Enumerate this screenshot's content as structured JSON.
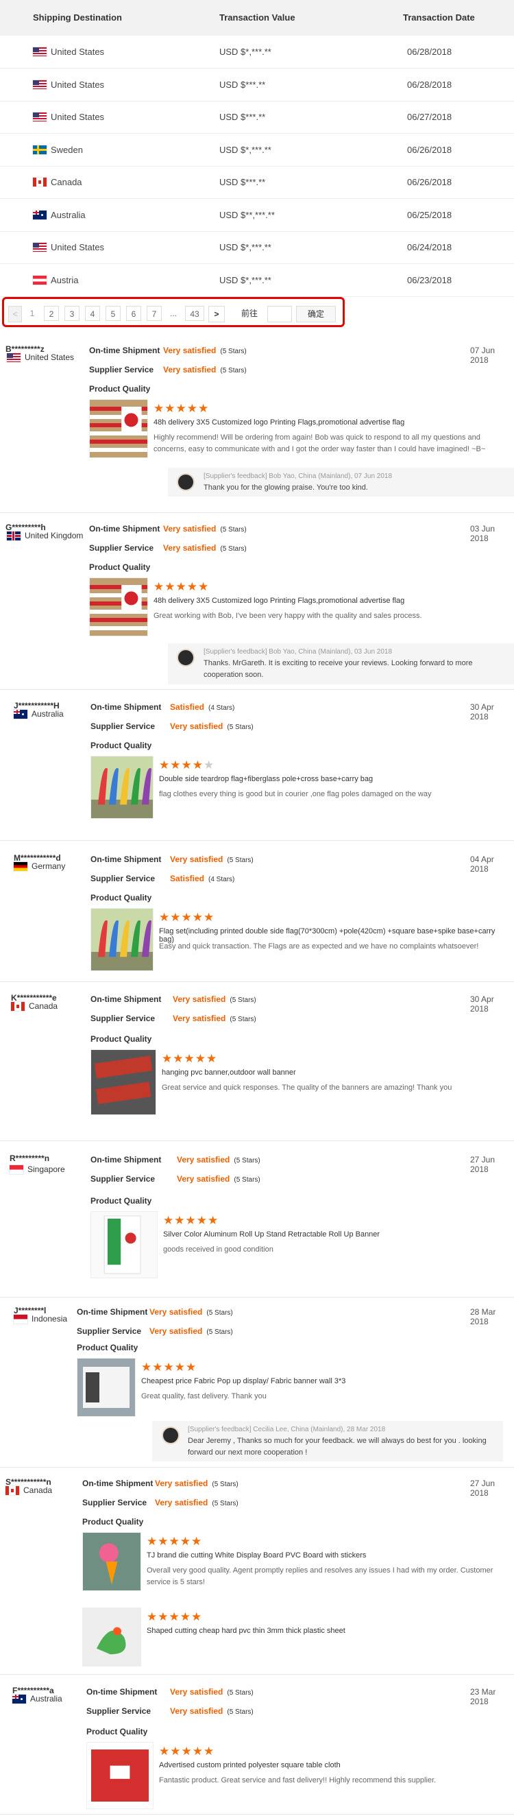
{
  "transactions": {
    "headers": {
      "dest": "Shipping Destination",
      "value": "Transaction Value",
      "date": "Transaction Date"
    },
    "rows": [
      {
        "flag": "us",
        "country": "United States",
        "value": "USD $*,***.**",
        "date": "06/28/2018"
      },
      {
        "flag": "us",
        "country": "United States",
        "value": "USD $***.**",
        "date": "06/28/2018"
      },
      {
        "flag": "us",
        "country": "United States",
        "value": "USD $***.**",
        "date": "06/27/2018"
      },
      {
        "flag": "se",
        "country": "Sweden",
        "value": "USD $*,***.**",
        "date": "06/26/2018"
      },
      {
        "flag": "ca",
        "country": "Canada",
        "value": "USD $***.**",
        "date": "06/26/2018"
      },
      {
        "flag": "au",
        "country": "Australia",
        "value": "USD $**,***.**",
        "date": "06/25/2018"
      },
      {
        "flag": "us",
        "country": "United States",
        "value": "USD $*,***.**",
        "date": "06/24/2018"
      },
      {
        "flag": "at",
        "country": "Austria",
        "value": "USD $*,***.**",
        "date": "06/23/2018"
      }
    ]
  },
  "pager": {
    "prev": "<",
    "pages": [
      "1",
      "2",
      "3",
      "4",
      "5",
      "6",
      "7"
    ],
    "ellipsis": "...",
    "last": "43",
    "next": ">",
    "goto_label": "前往",
    "confirm": "确定",
    "current": "1",
    "accent": "#e10600"
  },
  "labels": {
    "shipment": "On-time Shipment",
    "service": "Supplier Service",
    "quality": "Product Quality"
  },
  "reviews": [
    {
      "buyer": "B*********z",
      "country": "United States",
      "flag": "us",
      "date": "07 Jun 2018",
      "shipment": "Very satisfied",
      "shipment_stars": "(5 Stars)",
      "service": "Very satisfied",
      "service_stars": "(5 Stars)",
      "items": [
        {
          "stars": 5,
          "product": "48h delivery 3X5 Customized logo Printing Flags,promotional advertise flag",
          "comment": "Highly recommend! Will be ordering from again! Bob was quick to respond to all my questions and concerns, easy to communicate with and I got the order way faster than I could have imagined! ~B~"
        }
      ],
      "feedback": {
        "header": "[Supplier's feedback] Bob Yao, China (Mainland), 07 Jun 2018",
        "body": "Thank you for the glowing praise. You're too kind."
      }
    },
    {
      "buyer": "G*********h",
      "country": "United Kingdom",
      "flag": "gb",
      "date": "03 Jun 2018",
      "shipment": "Very satisfied",
      "shipment_stars": "(5 Stars)",
      "service": "Very satisfied",
      "service_stars": "(5 Stars)",
      "items": [
        {
          "stars": 5,
          "product": "48h delivery 3X5 Customized logo Printing Flags,promotional advertise flag",
          "comment": "Great working with Bob, I've been very happy with the quality and sales process."
        }
      ],
      "feedback": {
        "header": "[Supplier's feedback] Bob Yao, China (Mainland), 03 Jun 2018",
        "body": "Thanks. MrGareth. It is exciting to receive your reviews. Looking forward to more cooperation soon."
      }
    },
    {
      "buyer": "J***********H",
      "country": "Australia",
      "flag": "au",
      "date": "30 Apr 2018",
      "shipment": "Satisfied",
      "shipment_stars": "(4 Stars)",
      "service": "Very satisfied",
      "service_stars": "(5 Stars)",
      "items": [
        {
          "stars": 4,
          "product": "Double side teardrop flag+fiberglass pole+cross base+carry bag",
          "comment": "flag clothes every thing is good but in courier ,one flag poles damaged on the way"
        }
      ]
    },
    {
      "buyer": "M***********d",
      "country": "Germany",
      "flag": "de",
      "date": "04 Apr 2018",
      "shipment": "Very satisfied",
      "shipment_stars": "(5 Stars)",
      "service": "Satisfied",
      "service_stars": "(4 Stars)",
      "items": [
        {
          "stars": 5,
          "product": "Flag set(including printed double side flag(70*300cm) +pole(420cm) +square base+spike base+carry bag)",
          "comment": "Easy and quick transaction. The Flags are as expected and we have no complaints whatsoever!"
        }
      ]
    },
    {
      "buyer": "K***********e",
      "country": "Canada",
      "flag": "ca",
      "date": "30 Apr 2018",
      "shipment": "Very satisfied",
      "shipment_stars": "(5 Stars)",
      "service": "Very satisfied",
      "service_stars": "(5 Stars)",
      "items": [
        {
          "stars": 5,
          "product": "hanging pvc banner,outdoor wall banner",
          "comment": "Great service and quick responses. The quality of the banners are amazing! Thank you"
        }
      ]
    },
    {
      "buyer": "R*********n",
      "country": "Singapore",
      "flag": "sg",
      "date": "27 Jun 2018",
      "shipment": "Very satisfied",
      "shipment_stars": "(5 Stars)",
      "service": "Very satisfied",
      "service_stars": "(5 Stars)",
      "items": [
        {
          "stars": 5,
          "product": "Silver Color Aluminum Roll Up Stand Retractable Roll Up Banner",
          "comment": "goods received in good condition"
        }
      ]
    },
    {
      "buyer": "J********l",
      "country": "Indonesia",
      "flag": "id",
      "date": "28 Mar 2018",
      "shipment": "Very satisfied",
      "shipment_stars": "(5 Stars)",
      "service": "Very satisfied",
      "service_stars": "(5 Stars)",
      "items": [
        {
          "stars": 5,
          "product": "Cheapest price Fabric Pop up display/ Fabric banner wall 3*3",
          "comment": "Great quality, fast delivery. Thank you"
        }
      ],
      "feedback": {
        "header": "[Supplier's feedback] Cecilia Lee, China (Mainland), 28 Mar 2018",
        "body": "Dear Jeremy , Thanks so much for your feedback. we will always do best for you . looking forward our next more cooperation !"
      }
    },
    {
      "buyer": "S***********n",
      "country": "Canada",
      "flag": "ca",
      "date": "27 Jun 2018",
      "shipment": "Very satisfied",
      "shipment_stars": "(5 Stars)",
      "service": "Very satisfied",
      "service_stars": "(5 Stars)",
      "items": [
        {
          "stars": 5,
          "product": "TJ brand die cutting White Display Board PVC Board with stickers",
          "comment": "Overall very good quality. Agent promptly replies and resolves any issues I had with my order. Customer service is 5 stars!"
        },
        {
          "stars": 5,
          "product": "Shaped cutting cheap hard pvc thin 3mm thick plastic sheet",
          "comment": ""
        }
      ]
    },
    {
      "buyer": "F**********a",
      "country": "Australia",
      "flag": "au",
      "date": "23 Mar 2018",
      "shipment": "Very satisfied",
      "shipment_stars": "(5 Stars)",
      "service": "Very satisfied",
      "service_stars": "(5 Stars)",
      "items": [
        {
          "stars": 5,
          "product": "Advertised custom printed polyester square table cloth",
          "comment": "Fantastic product. Great service and fast delivery!! Highly recommend this supplier."
        }
      ]
    }
  ]
}
